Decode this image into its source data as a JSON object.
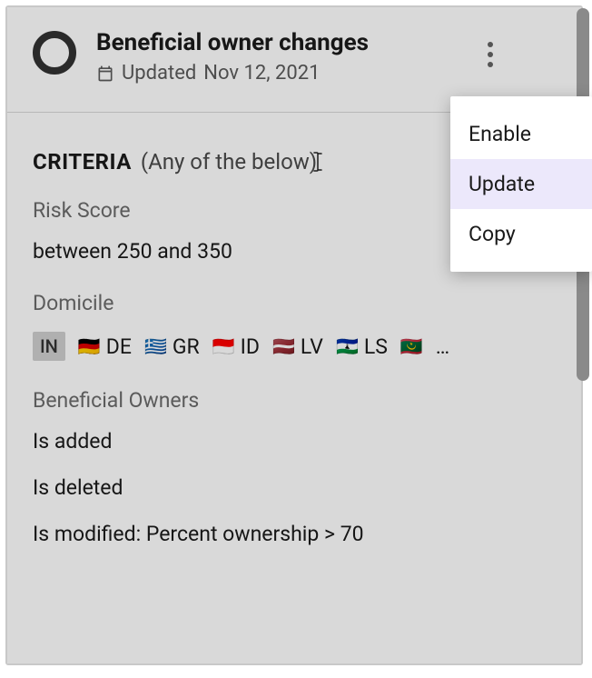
{
  "header": {
    "title": "Beneficial owner changes",
    "updated_prefix": "Updated",
    "updated_date": "Nov 12, 2021"
  },
  "criteria": {
    "label": "CRITERIA",
    "qualifier": "(Any of the below)",
    "risk_score": {
      "label": "Risk Score",
      "value": "between 250 and 350"
    },
    "domicile": {
      "label": "Domicile",
      "operator": "IN",
      "countries": [
        {
          "code": "DE",
          "flag": "🇩🇪"
        },
        {
          "code": "GR",
          "flag": "🇬🇷"
        },
        {
          "code": "ID",
          "flag": "🇮🇩"
        },
        {
          "code": "LV",
          "flag": "🇱🇻"
        },
        {
          "code": "LS",
          "flag": "🇱🇸"
        }
      ],
      "more_indicator": "…",
      "more_flag": "🇲🇷"
    },
    "beneficial_owners": {
      "label": "Beneficial Owners",
      "items": [
        "Is added",
        "Is deleted",
        "Is modified: Percent ownership > 70"
      ]
    }
  },
  "menu": {
    "items": [
      {
        "label": "Enable",
        "highlighted": false
      },
      {
        "label": "Update",
        "highlighted": true
      },
      {
        "label": "Copy",
        "highlighted": false
      }
    ]
  }
}
